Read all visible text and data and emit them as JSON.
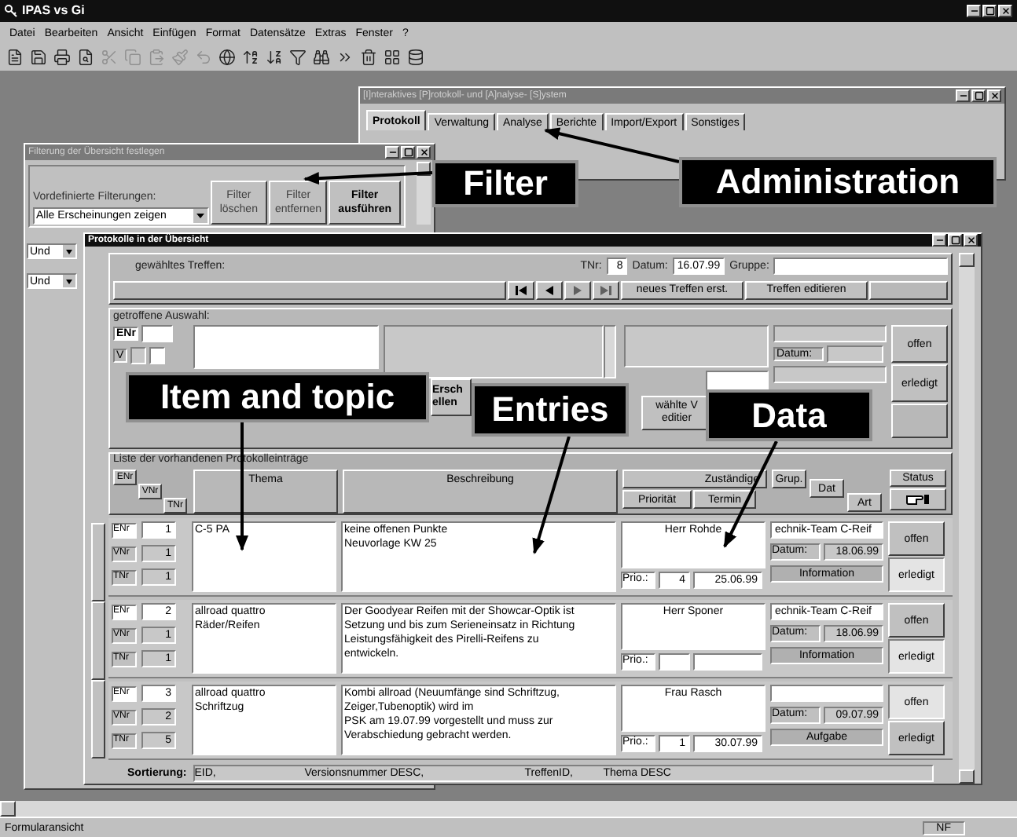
{
  "app": {
    "title": "IPAS vs Gi"
  },
  "menu": [
    "Datei",
    "Bearbeiten",
    "Ansicht",
    "Einfügen",
    "Format",
    "Datensätze",
    "Extras",
    "Fenster",
    "?"
  ],
  "main_window": {
    "title": "[I]nteraktives [P]rotokoll- und [A]nalyse- [S]ystem",
    "active": false,
    "tabs": [
      {
        "label": "Protokoll",
        "selected": true
      },
      {
        "label": "Verwaltung",
        "selected": false
      },
      {
        "label": "Analyse",
        "selected": false
      },
      {
        "label": "Berichte",
        "selected": false
      },
      {
        "label": "Import/Export",
        "selected": false
      },
      {
        "label": "Sonstiges",
        "selected": false
      }
    ]
  },
  "filter_window": {
    "title": "Filterung der Übersicht festlegen",
    "active": false,
    "label": "Vordefinierte Filterungen:",
    "preset": "Alle Erscheinungen zeigen",
    "buttons": [
      {
        "label": "Filter\nlöschen",
        "bold": false
      },
      {
        "label": "Filter\nentfernen",
        "bold": false
      },
      {
        "label": "Filter\nausführen",
        "bold": true
      }
    ],
    "operators": [
      "Und",
      "Und"
    ]
  },
  "protocol_window": {
    "title": "Protokolle in der Übersicht",
    "active": true,
    "meeting": {
      "label": "gewähltes Treffen:",
      "tnr_label": "TNr:",
      "tnr": "8",
      "date_label": "Datum:",
      "date": "16.07.99",
      "group_label": "Gruppe:",
      "buttons": [
        "neues Treffen erst.",
        "Treffen editieren"
      ]
    },
    "selection": {
      "label": "getroffene Auswahl:",
      "enr_label": "ENr",
      "vnr_label": "V",
      "date_label": "Datum:",
      "buttons": [
        "Ersch\nellen",
        "wählte V\neditier"
      ],
      "status_buttons": [
        "offen",
        "erledigt"
      ]
    },
    "list": {
      "title": "Liste der vorhandenen Protokolleinträge",
      "columns": [
        "ENr",
        "VNr",
        "TNr",
        "Thema",
        "Beschreibung",
        "Zuständige",
        "Priorität",
        "Termin",
        "Grup.",
        "Dat",
        "Art",
        "Status"
      ],
      "rows": [
        {
          "enr": "1",
          "vnr": "1",
          "tnr": "1",
          "labels": [
            "ENr",
            "VNr",
            "TNr"
          ],
          "thema": "C-5 PA",
          "beschreibung": "keine offenen Punkte\nNeuvorlage KW 25",
          "zustaendig": "Herr Rohde",
          "prio_label": "Prio.:",
          "prio": "4",
          "termin": "25.06.99",
          "team": "echnik-Team C-Reif",
          "date_label": "Datum:",
          "datum": "18.06.99",
          "art": "Information",
          "status": [
            {
              "label": "offen",
              "selected": false
            },
            {
              "label": "erledigt",
              "selected": true
            }
          ]
        },
        {
          "enr": "2",
          "vnr": "1",
          "tnr": "1",
          "labels": [
            "ENr",
            "VNr",
            "TNr"
          ],
          "thema": "allroad quattro\nRäder/Reifen",
          "beschreibung": "Der Goodyear Reifen mit der Showcar-Optik ist\nSetzung und bis zum Serieneinsatz in Richtung\nLeistungsfähigkeit des Pirelli-Reifens zu\nentwickeln.",
          "zustaendig": "Herr Sponer",
          "prio_label": "Prio.:",
          "prio": "",
          "termin": "",
          "team": "echnik-Team C-Reif",
          "date_label": "Datum:",
          "datum": "18.06.99",
          "art": "Information",
          "status": [
            {
              "label": "offen",
              "selected": false
            },
            {
              "label": "erledigt",
              "selected": true
            }
          ]
        },
        {
          "enr": "3",
          "vnr": "2",
          "tnr": "5",
          "labels": [
            "ENr",
            "VNr",
            "TNr"
          ],
          "thema": "allroad quattro\nSchriftzug",
          "beschreibung": "Kombi allroad (Neuumfänge sind Schriftzug,\nZeiger,Tubenoptik) wird im\nPSK am 19.07.99 vorgestellt und muss zur\nVerabschiedung gebracht werden.",
          "zustaendig": "Frau Rasch",
          "prio_label": "Prio.:",
          "prio": "1",
          "termin": "30.07.99",
          "team": "",
          "date_label": "Datum:",
          "datum": "09.07.99",
          "art": "Aufgabe",
          "status": [
            {
              "label": "offen",
              "selected": true
            },
            {
              "label": "erledigt",
              "selected": false
            }
          ]
        }
      ]
    },
    "sort": {
      "label": "Sortierung:",
      "parts": [
        "EID,",
        "Versionsnummer DESC,",
        "TreffenID,",
        "Thema DESC"
      ]
    }
  },
  "status_bar": {
    "text": "Formularansicht",
    "indicator": "NF"
  },
  "callouts": [
    {
      "text": "Filter"
    },
    {
      "text": "Administration"
    },
    {
      "text": "Item and topic"
    },
    {
      "text": "Entries"
    },
    {
      "text": "Data"
    }
  ]
}
